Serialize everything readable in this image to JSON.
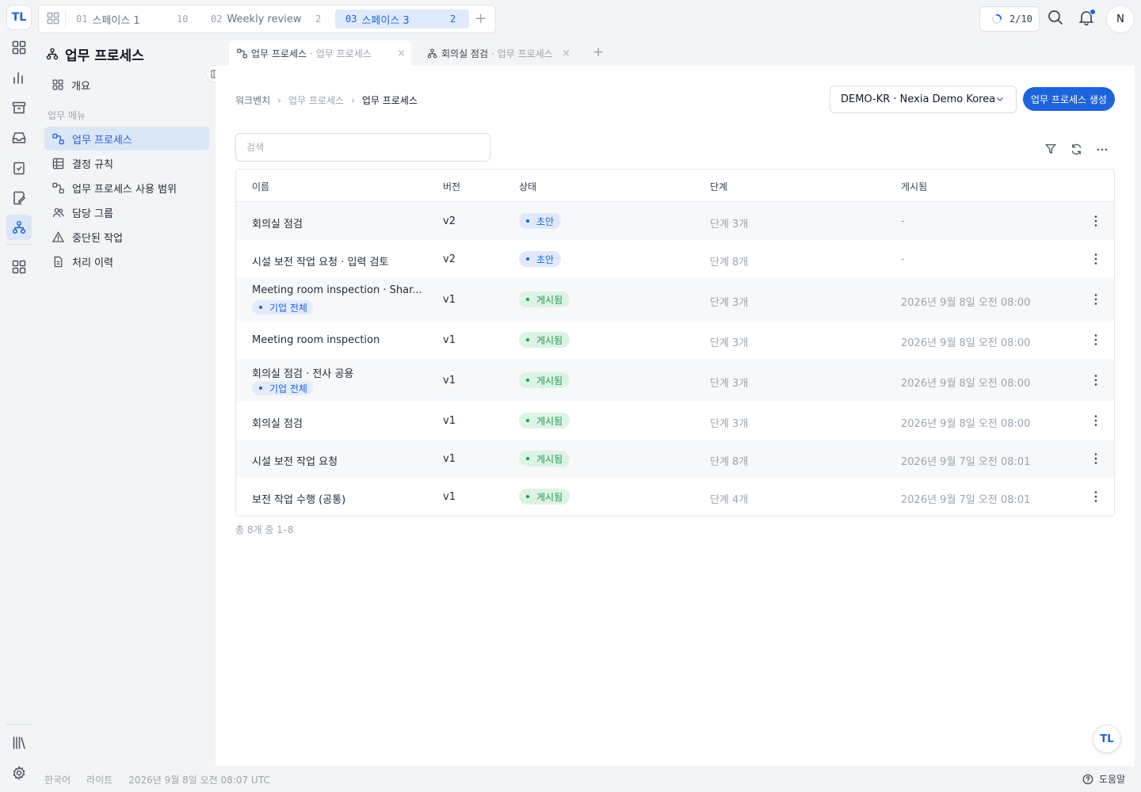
{
  "app": {
    "logo_text": "TL",
    "brand_color": "#1d63db"
  },
  "space_tabs": [
    {
      "num": "01",
      "label": "스페이스 1",
      "count": "10",
      "active": false
    },
    {
      "num": "02",
      "label": "Weekly review",
      "count": "2",
      "active": false
    },
    {
      "num": "03",
      "label": "스페이스 3",
      "count": "2",
      "active": true
    }
  ],
  "topbar": {
    "progress": "2/10",
    "avatar": "N"
  },
  "sidebar": {
    "title": "업무 프로세스",
    "overview": "개요",
    "section_label": "업무 메뉴",
    "items": [
      {
        "label": "업무 프로세스",
        "icon": "workflow-icon",
        "active": true
      },
      {
        "label": "결정 규칙",
        "icon": "table-icon",
        "active": false
      },
      {
        "label": "업무 프로세스 사용 범위",
        "icon": "workflow-icon",
        "active": false
      },
      {
        "label": "담당 그룹",
        "icon": "users-icon",
        "active": false
      },
      {
        "label": "중단된 작업",
        "icon": "warning-icon",
        "active": false
      },
      {
        "label": "처리 이력",
        "icon": "document-icon",
        "active": false
      }
    ]
  },
  "page_tabs": [
    {
      "title": "업무 프로세스",
      "sub": "· 업무 프로세스",
      "active": true
    },
    {
      "title": "회의실 점검",
      "sub": "· 업무 프로세스",
      "active": false
    }
  ],
  "breadcrumb": [
    "워크벤치",
    "업무 프로세스",
    "업무 프로세스"
  ],
  "tenant_select": "DEMO-KR · Nexia Demo Korea",
  "create_button": "업무 프로세스 생성",
  "search": {
    "placeholder": "검색",
    "value": ""
  },
  "table": {
    "headers": [
      "이름",
      "버전",
      "상태",
      "단계",
      "게시됨"
    ],
    "rows": [
      {
        "name": "회의실 점검",
        "tag": "",
        "version": "v2",
        "status": "초안",
        "status_kind": "draft",
        "steps": "단계 3개",
        "published": "-"
      },
      {
        "name": "시설 보전 작업 요청 · 입력 검토",
        "tag": "",
        "version": "v2",
        "status": "초안",
        "status_kind": "draft",
        "steps": "단계 8개",
        "published": "-"
      },
      {
        "name": "Meeting room inspection · Shar...",
        "tag": "기업 전체",
        "version": "v1",
        "status": "게시됨",
        "status_kind": "pub",
        "steps": "단계 3개",
        "published": "2026년 9월 8일 오전 08:00"
      },
      {
        "name": "Meeting room inspection",
        "tag": "",
        "version": "v1",
        "status": "게시됨",
        "status_kind": "pub",
        "steps": "단계 3개",
        "published": "2026년 9월 8일 오전 08:00"
      },
      {
        "name": "회의실 점검 · 전사 공용",
        "tag": "기업 전체",
        "version": "v1",
        "status": "게시됨",
        "status_kind": "pub",
        "steps": "단계 3개",
        "published": "2026년 9월 8일 오전 08:00"
      },
      {
        "name": "회의실 점검",
        "tag": "",
        "version": "v1",
        "status": "게시됨",
        "status_kind": "pub",
        "steps": "단계 3개",
        "published": "2026년 9월 8일 오전 08:00"
      },
      {
        "name": "시설 보전 작업 요청",
        "tag": "",
        "version": "v1",
        "status": "게시됨",
        "status_kind": "pub",
        "steps": "단계 8개",
        "published": "2026년 9월 7일 오전 08:01"
      },
      {
        "name": "보전 작업 수행 (공통)",
        "tag": "",
        "version": "v1",
        "status": "게시됨",
        "status_kind": "pub",
        "steps": "단계 4개",
        "published": "2026년 9월 7일 오전 08:01"
      }
    ],
    "footer": "총 8개 중 1–8"
  },
  "statusbar": {
    "language": "한국어",
    "theme": "라이트",
    "datetime": "2026년 9월 8일 오전 08:07 UTC",
    "help": "도움말"
  }
}
